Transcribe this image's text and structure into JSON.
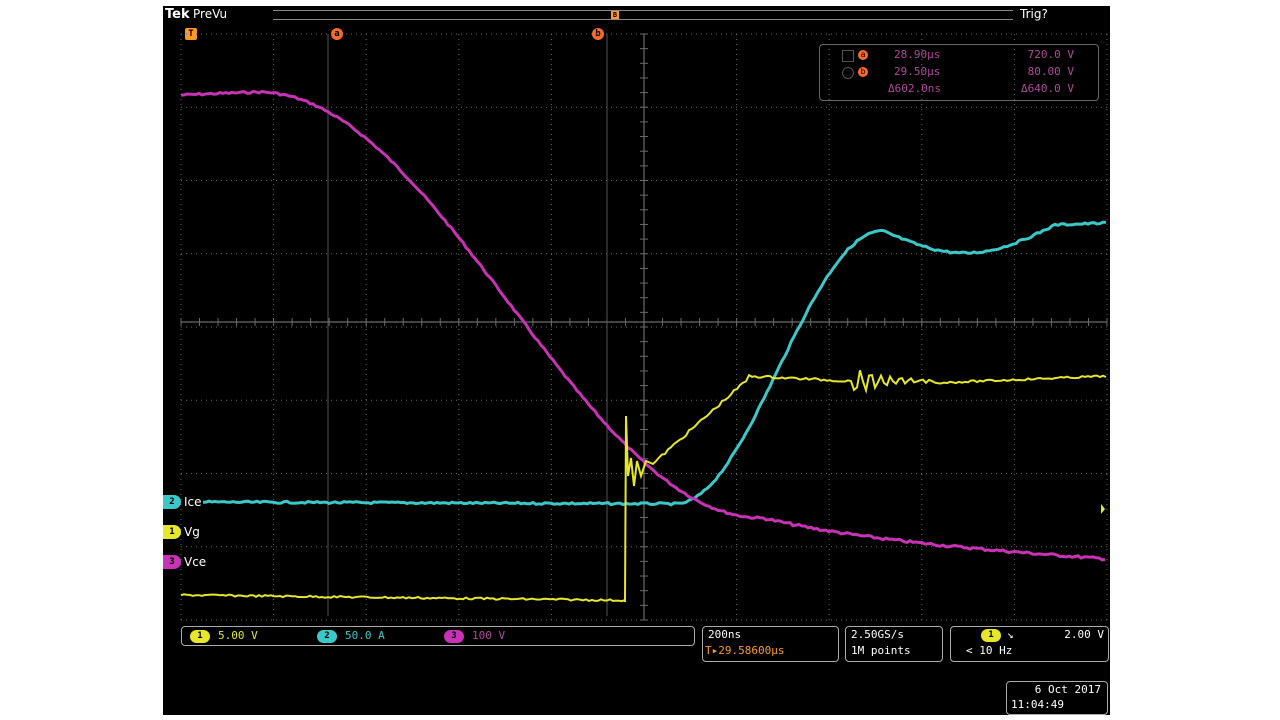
{
  "header": {
    "brand": "Tek",
    "mode": "PreVu",
    "status": "Trig?"
  },
  "colors": {
    "ch1": "#e6e62a",
    "ch2": "#3cc8c8",
    "ch3": "#c832b4",
    "cursor": "#ff6a2a",
    "grid": "#9a9a9a",
    "dim": "#b0489e"
  },
  "cursor_readout": {
    "a": {
      "label": "a",
      "time": "28.90μs",
      "value": "720.0 V"
    },
    "b": {
      "label": "b",
      "time": "29.50μs",
      "value": "80.00 V"
    },
    "delta": {
      "time": "Δ602.0ns",
      "value": "Δ640.0 V"
    }
  },
  "markers": {
    "trigger_pos": "T",
    "cursor_a": "a",
    "cursor_b": "b",
    "expand": "B"
  },
  "channels": [
    {
      "id": "2",
      "name": "Ice",
      "scale": "50.0 A"
    },
    {
      "id": "1",
      "name": "Vg",
      "scale": "5.00 V"
    },
    {
      "id": "3",
      "name": "Vce",
      "scale": "100 V"
    }
  ],
  "timebase": {
    "scale": "200ns",
    "position": "29.58600μs",
    "position_prefix": "T▸"
  },
  "acquisition": {
    "rate": "2.50GS/s",
    "points": "1M points"
  },
  "trigger": {
    "channel": "1",
    "slope_icon": "falling-edge-icon",
    "level": "2.00 V",
    "freq": "< 10 Hz"
  },
  "datetime": {
    "date": "6 Oct  2017",
    "time": "11:04:49"
  }
}
